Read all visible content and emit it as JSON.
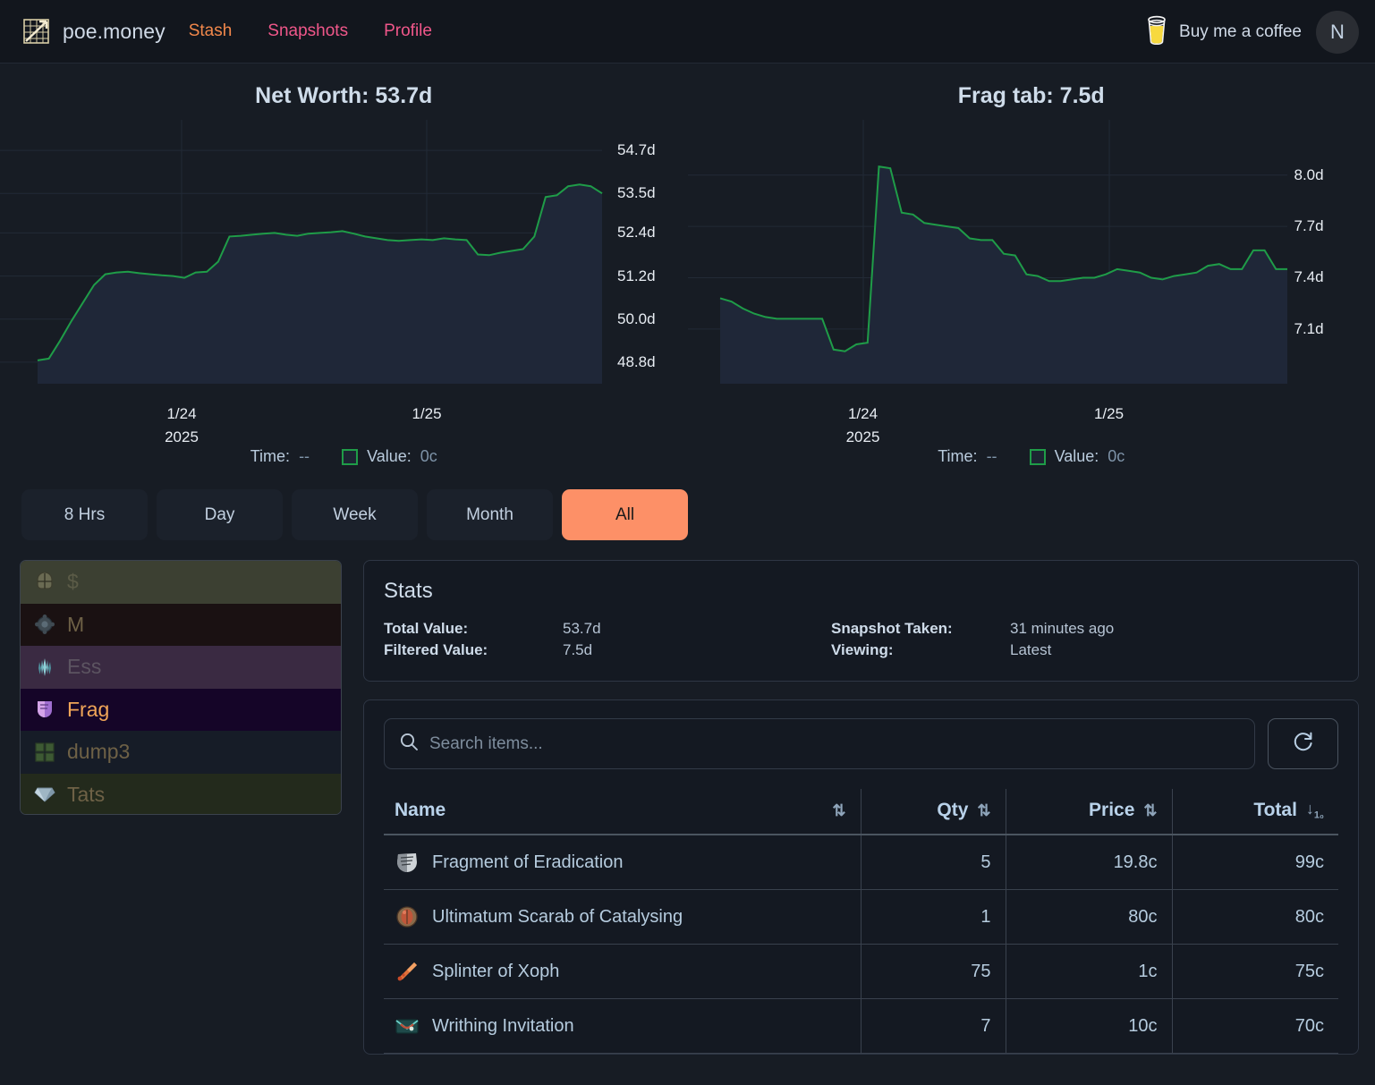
{
  "header": {
    "logo_icon": "chart-grid-logo",
    "brand": "poe.money",
    "nav": [
      {
        "label": "Stash",
        "color": "#f2884b"
      },
      {
        "label": "Snapshots",
        "color": "#f0578a"
      },
      {
        "label": "Profile",
        "color": "#f0578a"
      }
    ],
    "coffee_label": "Buy me a coffee",
    "coffee_icon": "coffee-cup-icon",
    "avatar_initial": "N"
  },
  "charts": [
    {
      "title": "Net Worth: 53.7d",
      "legend_time_label": "Time:",
      "legend_time_value": "--",
      "legend_value_label": "Value:",
      "legend_value_value": "0c"
    },
    {
      "title": "Frag tab: 7.5d",
      "legend_time_label": "Time:",
      "legend_time_value": "--",
      "legend_value_label": "Value:",
      "legend_value_value": "0c"
    }
  ],
  "chart_data": [
    {
      "type": "area",
      "title": "Net Worth: 53.7d",
      "xlabel": "",
      "ylabel": "",
      "grid": true,
      "legend_position": "below",
      "line_color": "#1f9c48",
      "fill_color": "#1f2738",
      "ytick_labels": [
        "54.7d",
        "53.5d",
        "52.4d",
        "51.2d",
        "50.0d",
        "48.8d"
      ],
      "ytick_values": [
        54.7,
        53.5,
        52.4,
        51.2,
        50.0,
        48.8
      ],
      "ylim": [
        48.2,
        55.2
      ],
      "xtick_labels": [
        "1/24",
        "1/25"
      ],
      "xtick_sublabels": [
        "2025",
        ""
      ],
      "x": [
        0,
        1,
        2,
        3,
        4,
        5,
        6,
        7,
        8,
        9,
        10,
        11,
        12,
        13,
        14,
        15,
        16,
        17,
        18,
        19,
        20,
        21,
        22,
        23,
        24,
        25,
        26,
        27,
        28,
        29,
        30,
        31,
        32,
        33,
        34,
        35,
        36,
        37,
        38,
        39,
        40,
        41,
        42,
        43,
        44,
        45,
        46,
        47,
        48,
        49,
        50
      ],
      "values": [
        48.85,
        48.9,
        49.4,
        49.95,
        50.45,
        50.95,
        51.25,
        51.3,
        51.32,
        51.28,
        51.25,
        51.22,
        51.2,
        51.15,
        51.3,
        51.32,
        51.6,
        52.3,
        52.32,
        52.35,
        52.38,
        52.4,
        52.35,
        52.32,
        52.38,
        52.4,
        52.42,
        52.45,
        52.38,
        52.3,
        52.25,
        52.2,
        52.18,
        52.2,
        52.22,
        52.2,
        52.25,
        52.22,
        52.2,
        51.8,
        51.78,
        51.85,
        51.9,
        51.95,
        52.3,
        53.4,
        53.45,
        53.7,
        53.75,
        53.7,
        53.5
      ]
    },
    {
      "type": "area",
      "title": "Frag tab: 7.5d",
      "xlabel": "",
      "ylabel": "",
      "grid": true,
      "legend_position": "below",
      "line_color": "#1f9c48",
      "fill_color": "#1f2738",
      "ytick_labels": [
        "8.0d",
        "7.7d",
        "7.4d",
        "7.1d"
      ],
      "ytick_values": [
        8.0,
        7.7,
        7.4,
        7.1
      ],
      "ylim": [
        6.78,
        8.25
      ],
      "xtick_labels": [
        "1/24",
        "1/25"
      ],
      "xtick_sublabels": [
        "2025",
        ""
      ],
      "x": [
        0,
        1,
        2,
        3,
        4,
        5,
        6,
        7,
        8,
        9,
        10,
        11,
        12,
        13,
        14,
        15,
        16,
        17,
        18,
        19,
        20,
        21,
        22,
        23,
        24,
        25,
        26,
        27,
        28,
        29,
        30,
        31,
        32,
        33,
        34,
        35,
        36,
        37,
        38,
        39,
        40,
        41,
        42,
        43,
        44,
        45,
        46,
        47,
        48,
        49,
        50
      ],
      "values": [
        7.28,
        7.26,
        7.22,
        7.19,
        7.17,
        7.16,
        7.16,
        7.16,
        7.16,
        7.16,
        6.98,
        6.97,
        7.01,
        7.02,
        8.05,
        8.04,
        7.78,
        7.77,
        7.72,
        7.71,
        7.7,
        7.69,
        7.63,
        7.62,
        7.62,
        7.54,
        7.53,
        7.42,
        7.41,
        7.38,
        7.38,
        7.39,
        7.4,
        7.4,
        7.42,
        7.45,
        7.44,
        7.43,
        7.4,
        7.39,
        7.41,
        7.42,
        7.43,
        7.47,
        7.48,
        7.45,
        7.45,
        7.56,
        7.56,
        7.45,
        7.45
      ]
    }
  ],
  "ranges": {
    "options": [
      "8 Hrs",
      "Day",
      "Week",
      "Month",
      "All"
    ],
    "selected": "All"
  },
  "tabs": [
    {
      "label": "$",
      "icon": "helmet-icon",
      "bg": "#3c4032",
      "text": "#5b5b47",
      "selected": false
    },
    {
      "label": "M",
      "icon": "gear-orb-icon",
      "bg": "#1a1112",
      "text": "#6e6146",
      "selected": false
    },
    {
      "label": "Ess",
      "icon": "essence-icon",
      "bg": "#3a2a42",
      "text": "#5c5461",
      "selected": false
    },
    {
      "label": "Frag",
      "icon": "fragment-icon",
      "bg": "#150528",
      "text": "#f0a558",
      "selected": true
    },
    {
      "label": "dump3",
      "icon": "quad-grid-icon",
      "bg": "#161c27",
      "text": "#6e6146",
      "selected": false
    },
    {
      "label": "Tats",
      "icon": "gem-icon",
      "bg": "#232a1c",
      "text": "#6e6146",
      "selected": false
    }
  ],
  "stats": {
    "title": "Stats",
    "total_value_label": "Total Value:",
    "total_value": "53.7d",
    "filtered_value_label": "Filtered Value:",
    "filtered_value": "7.5d",
    "snapshot_taken_label": "Snapshot Taken:",
    "snapshot_taken": "31 minutes ago",
    "viewing_label": "Viewing:",
    "viewing": "Latest"
  },
  "search": {
    "placeholder": "Search items...",
    "value": "",
    "icon": "search-icon",
    "refresh_icon": "refresh-icon"
  },
  "table": {
    "columns": [
      {
        "label": "Name",
        "sort_icon": "sort-both-icon",
        "align": "left"
      },
      {
        "label": "Qty",
        "sort_icon": "sort-both-icon",
        "align": "right"
      },
      {
        "label": "Price",
        "sort_icon": "sort-both-icon",
        "align": "right"
      },
      {
        "label": "Total",
        "sort_icon": "sort-desc-numeric-icon",
        "align": "right"
      }
    ],
    "rows": [
      {
        "icon": "fragment-eradication-icon",
        "name": "Fragment of Eradication",
        "qty": "5",
        "price": "19.8c",
        "total": "99c"
      },
      {
        "icon": "scarab-icon",
        "name": "Ultimatum Scarab of Catalysing",
        "qty": "1",
        "price": "80c",
        "total": "80c"
      },
      {
        "icon": "splinter-icon",
        "name": "Splinter of Xoph",
        "qty": "75",
        "price": "1c",
        "total": "75c"
      },
      {
        "icon": "invitation-icon",
        "name": "Writhing Invitation",
        "qty": "7",
        "price": "10c",
        "total": "70c"
      }
    ]
  },
  "colors": {
    "page_bg": "#171c24",
    "nav_bg": "#12161d",
    "accent_orange": "#fd9067",
    "accent_pink": "#f0578a",
    "line_green": "#1f9c48",
    "area_fill": "#1f2738"
  }
}
